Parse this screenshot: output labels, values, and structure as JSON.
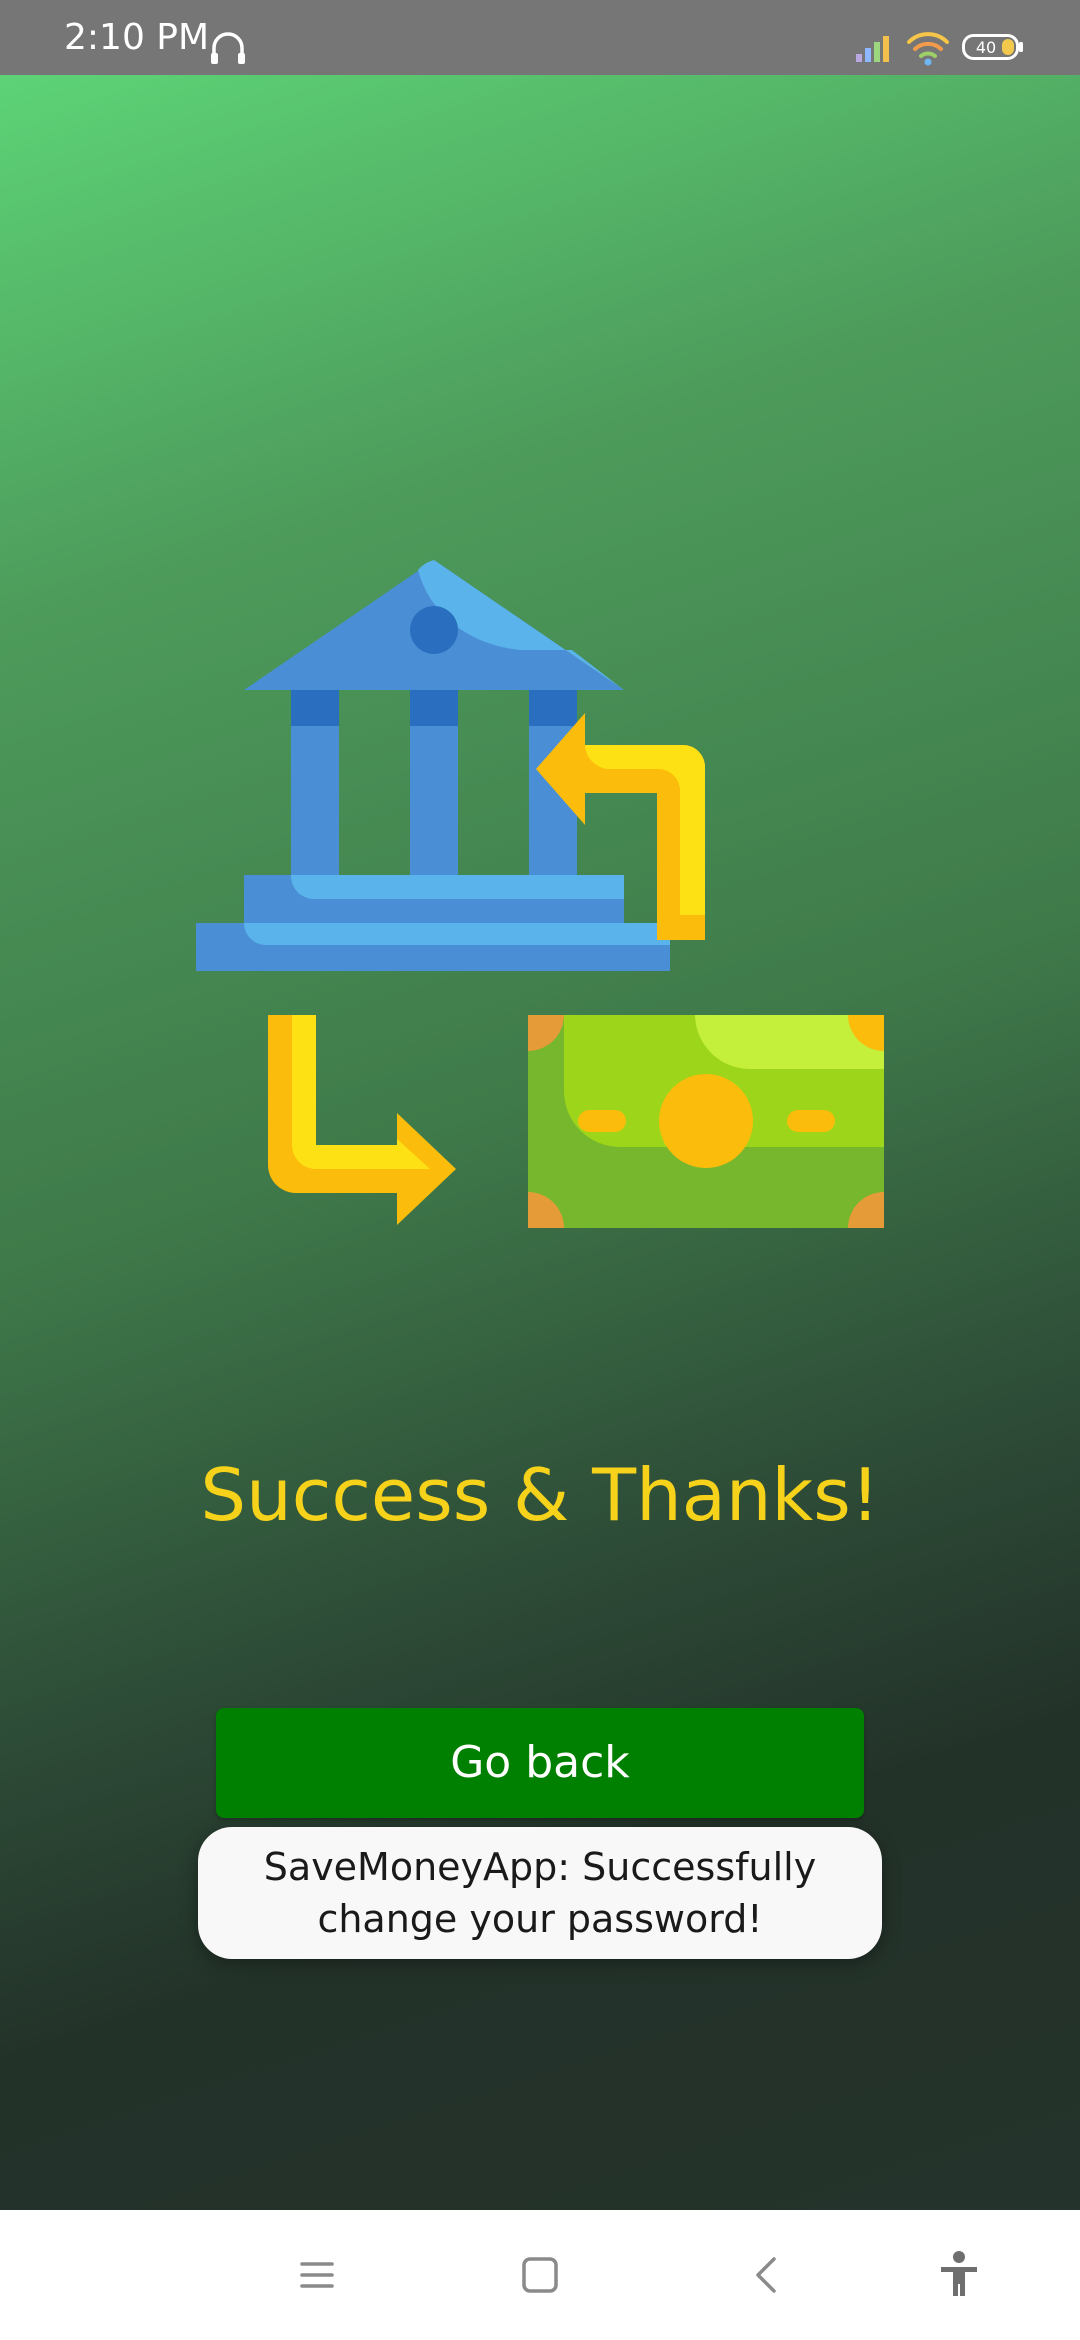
{
  "status_bar": {
    "time": "2:10 PM",
    "battery_level": "40",
    "icons": [
      "headphones-icon",
      "signal-icon",
      "wifi-icon",
      "battery-icon"
    ]
  },
  "main": {
    "illustration": "bank-money-transfer-illustration",
    "headline": "Success & Thanks!",
    "go_back_label": "Go back"
  },
  "toast": {
    "line1": "SaveMoneyApp: Successfully",
    "line2": "change your password!"
  },
  "nav_bar": {
    "icons": [
      "menu-icon",
      "home-icon",
      "back-icon",
      "accessibility-icon"
    ]
  },
  "colors": {
    "status_bar": "#767676",
    "gradient_top": "#5dd376",
    "gradient_bottom": "#24332b",
    "headline": "#f6d31a",
    "button": "#008000",
    "toast_bg": "#f8f8f8"
  }
}
